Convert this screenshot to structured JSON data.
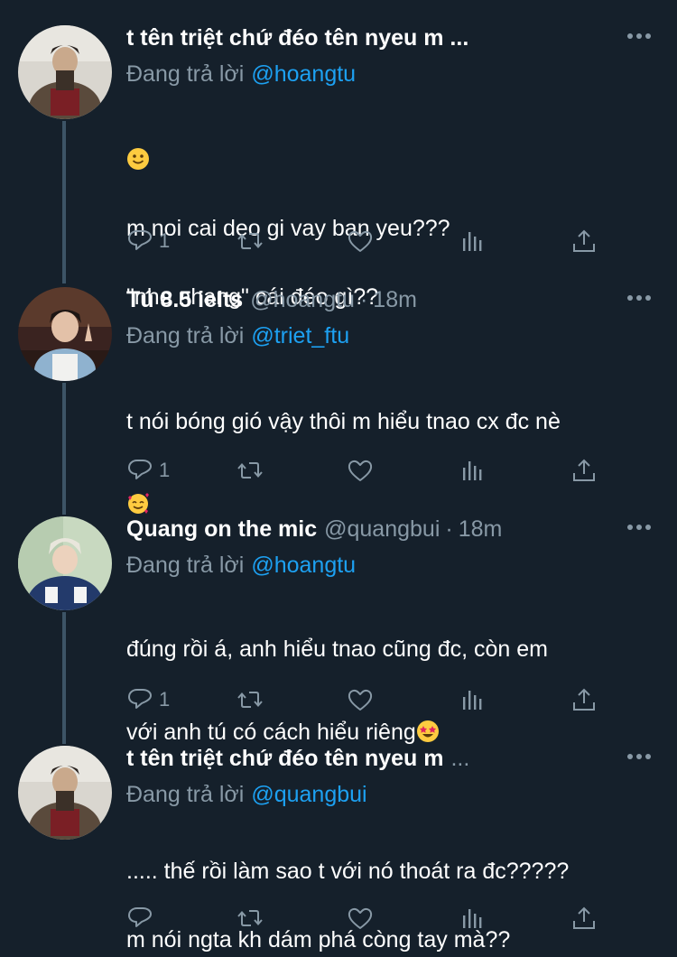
{
  "tweets": [
    {
      "name": "t tên triệt chứ đéo tên nyeu m ...",
      "handle": "",
      "time": "",
      "reply_label": "Đang trả lời",
      "reply_to": "@hoangtu",
      "line1": "m noi cai deo gi vay ban yeu???",
      "line2": "\"nhe nhang\" cái đéo gì??",
      "reply_count": "1"
    },
    {
      "name": "Tú 8.5 ielts",
      "handle": "@hoangtu",
      "time": "18m",
      "reply_label": "Đang trả lời",
      "reply_to": "@triet_ftu",
      "line1": "t nói bóng gió vậy thôi m hiểu tnao cx đc nè",
      "reply_count": "1"
    },
    {
      "name": "Quang on the mic",
      "handle": "@quangbui",
      "time": "18m",
      "reply_label": "Đang trả lời",
      "reply_to": "@hoangtu",
      "line1": "đúng rồi á, anh hiểu tnao cũng đc, còn em",
      "line2": "với anh tú có cách hiểu riêng",
      "reply_count": "1"
    },
    {
      "name": "t tên triệt chứ đéo tên nyeu m",
      "handle": "",
      "time": "",
      "reply_label": "Đang trả lời",
      "reply_to": "@quangbui",
      "line1": "..... thế rồi làm sao t với nó thoát ra đc?????",
      "line2": "m nói ngta kh dám phá còng tay mà??",
      "reply_count": ""
    }
  ],
  "ellipsis": "...",
  "separator": "·",
  "icons": [
    "reply-icon",
    "retweet-icon",
    "like-icon",
    "analytics-icon",
    "share-icon",
    "more-icon"
  ],
  "colors": {
    "background": "#15202b",
    "secondary": "#8899a6",
    "accent": "#1da1f2",
    "thread": "#3d5466"
  }
}
